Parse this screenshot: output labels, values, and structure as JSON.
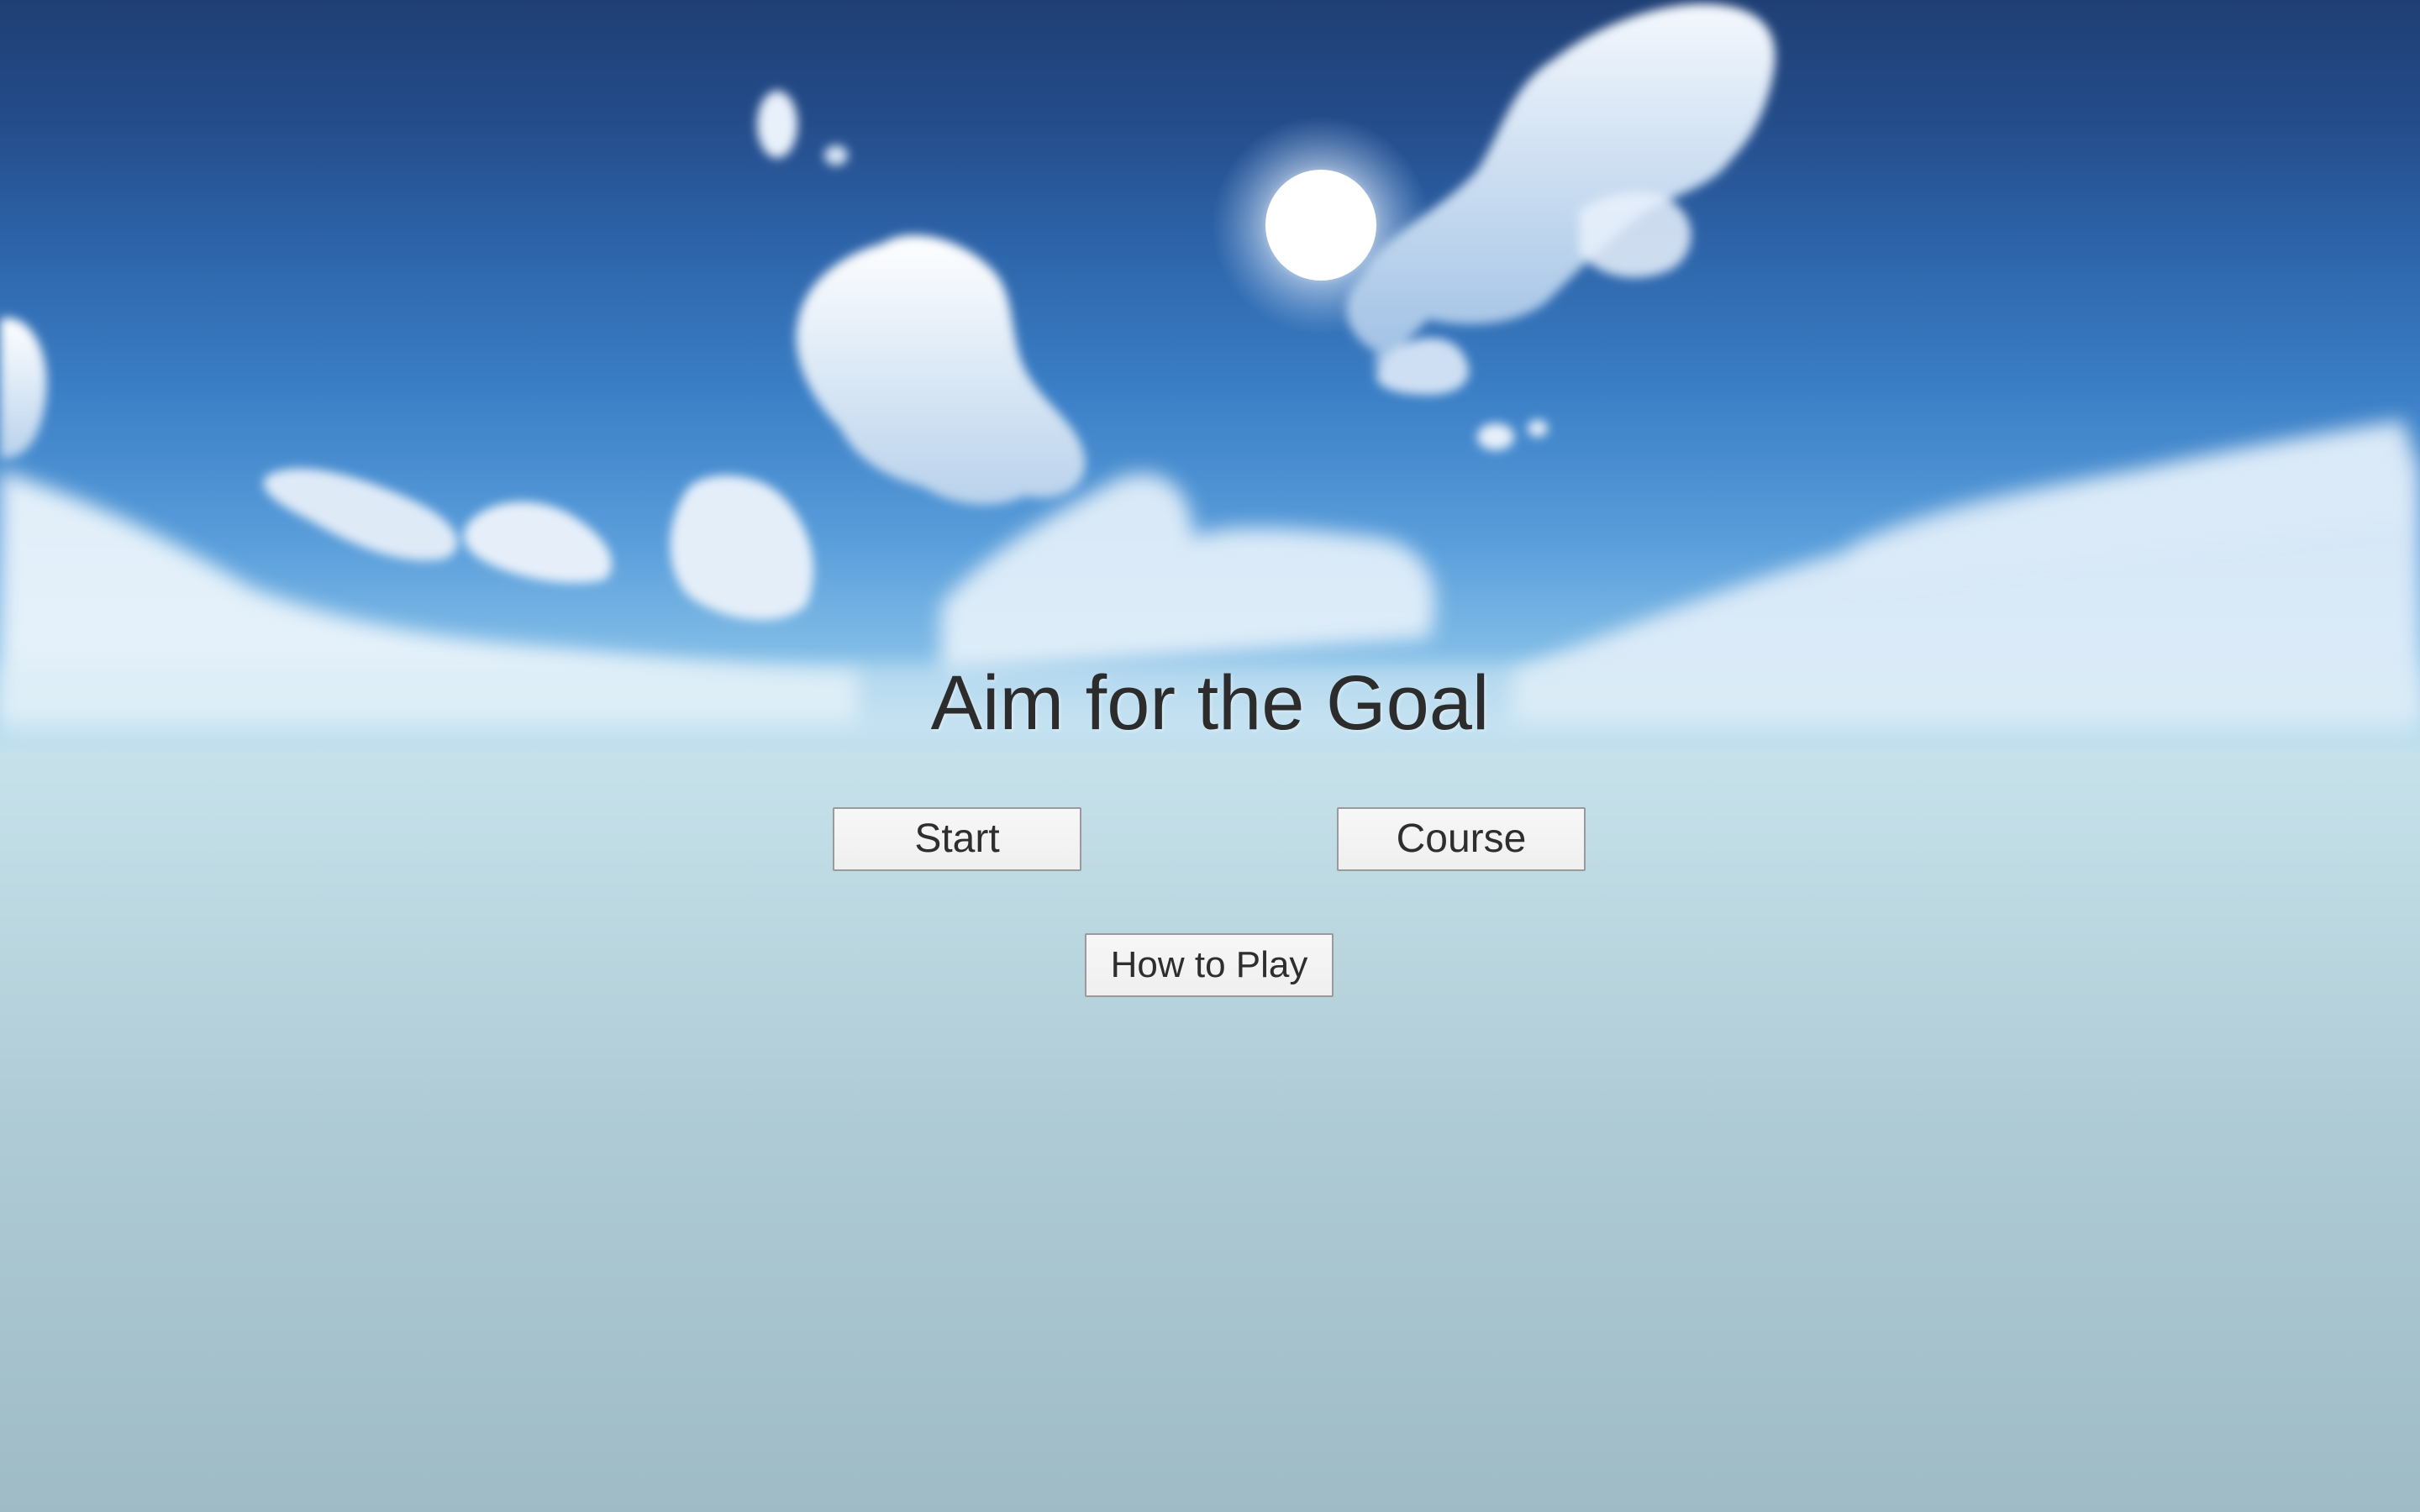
{
  "title": "Aim for the Goal",
  "menu": {
    "start_label": "Start",
    "course_label": "Course",
    "how_to_play_label": "How to Play"
  },
  "colors": {
    "sky_top": "#1f3f74",
    "sky_horizon": "#c6e1ea",
    "ground_bottom": "#9fbcc6",
    "button_bg": "#f2f2f2",
    "button_border": "#9a9a9a",
    "text": "#2c2c2c"
  }
}
